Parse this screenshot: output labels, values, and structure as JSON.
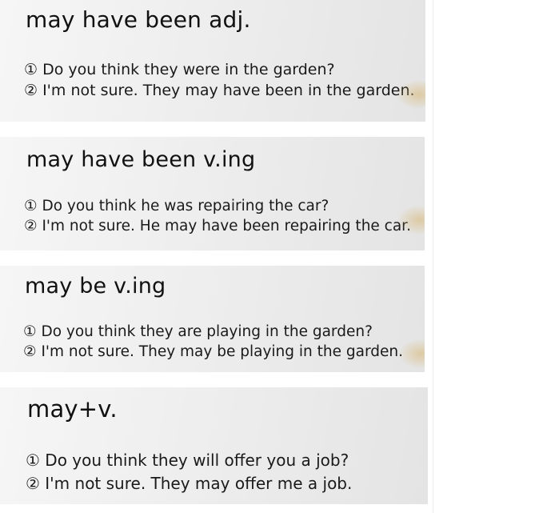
{
  "cards": [
    {
      "title": "may have been adj.",
      "lines": [
        "① Do you think they were in the garden?",
        "② I'm not sure. They may have been in the garden."
      ]
    },
    {
      "title": "may have been v.ing",
      "lines": [
        "① Do you think he was repairing the car?",
        "② I'm not sure. He may have been repairing the car."
      ]
    },
    {
      "title": "may be v.ing",
      "lines": [
        "① Do you think they are playing in the garden?",
        "② I'm not sure. They may be playing in the garden."
      ]
    },
    {
      "title": "may+v.",
      "lines": [
        "① Do you think they will offer you a job?",
        "② I'm not sure. They may offer me a job."
      ]
    }
  ]
}
